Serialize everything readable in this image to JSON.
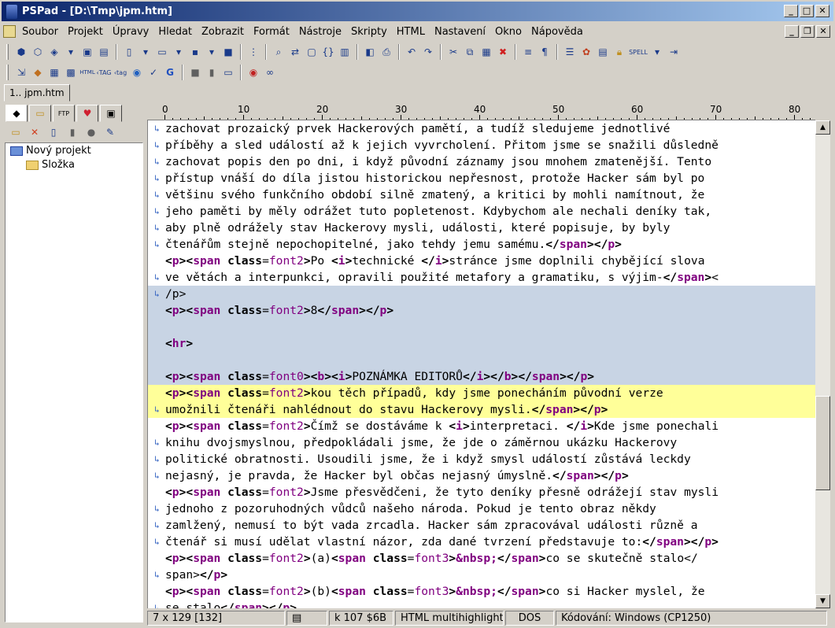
{
  "window": {
    "title": "PSPad - [D:\\Tmp\\jpm.htm]"
  },
  "menu": [
    "Soubor",
    "Projekt",
    "Úpravy",
    "Hledat",
    "Zobrazit",
    "Formát",
    "Nástroje",
    "Skripty",
    "HTML",
    "Nastavení",
    "Okno",
    "Nápověda"
  ],
  "doc_tab": "1.. jpm.htm",
  "tree": {
    "project": "Nový projekt",
    "folder": "Složka"
  },
  "ruler": [
    "0",
    "10",
    "20",
    "30",
    "40",
    "50",
    "60",
    "70",
    "80"
  ],
  "lines": [
    {
      "wrap": true,
      "code": "zachovat prozaický prvek Hackerových pamětí, a tudíž sledujeme jednotlivé"
    },
    {
      "wrap": true,
      "code": "příběhy a sled událostí až k jejich vyvrcholení. Přitom jsme se snažili důsledně"
    },
    {
      "wrap": true,
      "code": "zachovat popis den po dni, i když původní záznamy jsou mnohem zmatenější. Tento"
    },
    {
      "wrap": true,
      "code": "přístup vnáší do díla jistou historickou nepřesnost, protože Hacker sám byl po"
    },
    {
      "wrap": true,
      "code": "většinu svého funkčního období silně zmatený, a kritici by mohli namítnout, že"
    },
    {
      "wrap": true,
      "code": "jeho paměti by měly odrážet tuto popletenost. Kdybychom ale nechali deníky tak,"
    },
    {
      "wrap": true,
      "code": "aby plně odrážely stav Hackerovy mysli, události, které popisuje, by byly"
    },
    {
      "wrap": true,
      "code": "čtenářům stejně nepochopitelné, jako tehdy jemu samému.</span></p>"
    },
    {
      "wrap": false,
      "code": "<p><span class=font2>Po <i>technické </i>stránce jsme doplnili chybějící slova"
    },
    {
      "wrap": true,
      "code": "ve větách a interpunkci, opravili použité metafory a gramatiku, s výjim-</span><"
    },
    {
      "wrap": true,
      "code": "/p>",
      "sel": true
    },
    {
      "wrap": false,
      "code": "<p><span class=font2>8</span></p>",
      "sel": true
    },
    {
      "wrap": false,
      "code": "",
      "sel": true
    },
    {
      "wrap": false,
      "code": "<hr>",
      "sel": true
    },
    {
      "wrap": false,
      "code": "",
      "sel": true
    },
    {
      "wrap": false,
      "code": "<p><span class=font0><b><i>POZNÁMKA EDITORŮ</i></b></span></p>",
      "sel": true
    },
    {
      "wrap": false,
      "code": "<p><span class=font2>kou těch případů, kdy jsme ponecháním původní verze",
      "hl": true
    },
    {
      "wrap": true,
      "code": "umožnili čtenáři nahlédnout do stavu Hackerovy mysli.</span></p>",
      "hl": true
    },
    {
      "wrap": false,
      "code": "<p><span class=font2>Čímž se dostáváme k <i>interpretaci. </i>Kde jsme ponechali"
    },
    {
      "wrap": true,
      "code": "knihu dvojsmyslnou, předpokládali jsme, že jde o záměrnou ukázku Hackerovy"
    },
    {
      "wrap": true,
      "code": "politické obratnosti. Usoudili jsme, že i když smysl událostí zůstává leckdy"
    },
    {
      "wrap": true,
      "code": "nejasný, je pravda, že Hacker byl občas nejasný úmyslně.</span></p>"
    },
    {
      "wrap": false,
      "code": "<p><span class=font2>Jsme přesvědčeni, že tyto deníky přesně odrážejí stav mysli"
    },
    {
      "wrap": true,
      "code": "jednoho z pozoruhodných vůdců našeho národa. Pokud je tento obraz někdy"
    },
    {
      "wrap": true,
      "code": "zamlžený, nemusí to být vada zrcadla. Hacker sám zpracovával události různě a"
    },
    {
      "wrap": true,
      "code": "čtenář si musí udělat vlastní názor, zda dané tvrzení představuje to:</span></p>"
    },
    {
      "wrap": false,
      "code": "<p><span class=font2>(a)<span class=font3>&nbsp;</span>co se skutečně stalo</"
    },
    {
      "wrap": true,
      "code": "span></p>"
    },
    {
      "wrap": false,
      "code": "<p><span class=font2>(b)<span class=font3>&nbsp;</span>co si Hacker myslel, že"
    },
    {
      "wrap": true,
      "code": "se stalo</span></p>"
    }
  ],
  "status": {
    "pos": "7 x 129  [132]",
    "char": "k  107  $6B",
    "highlighter": "HTML multihighlighter",
    "eol": "DOS",
    "encoding": "Kódování: Windows (CP1250)"
  }
}
